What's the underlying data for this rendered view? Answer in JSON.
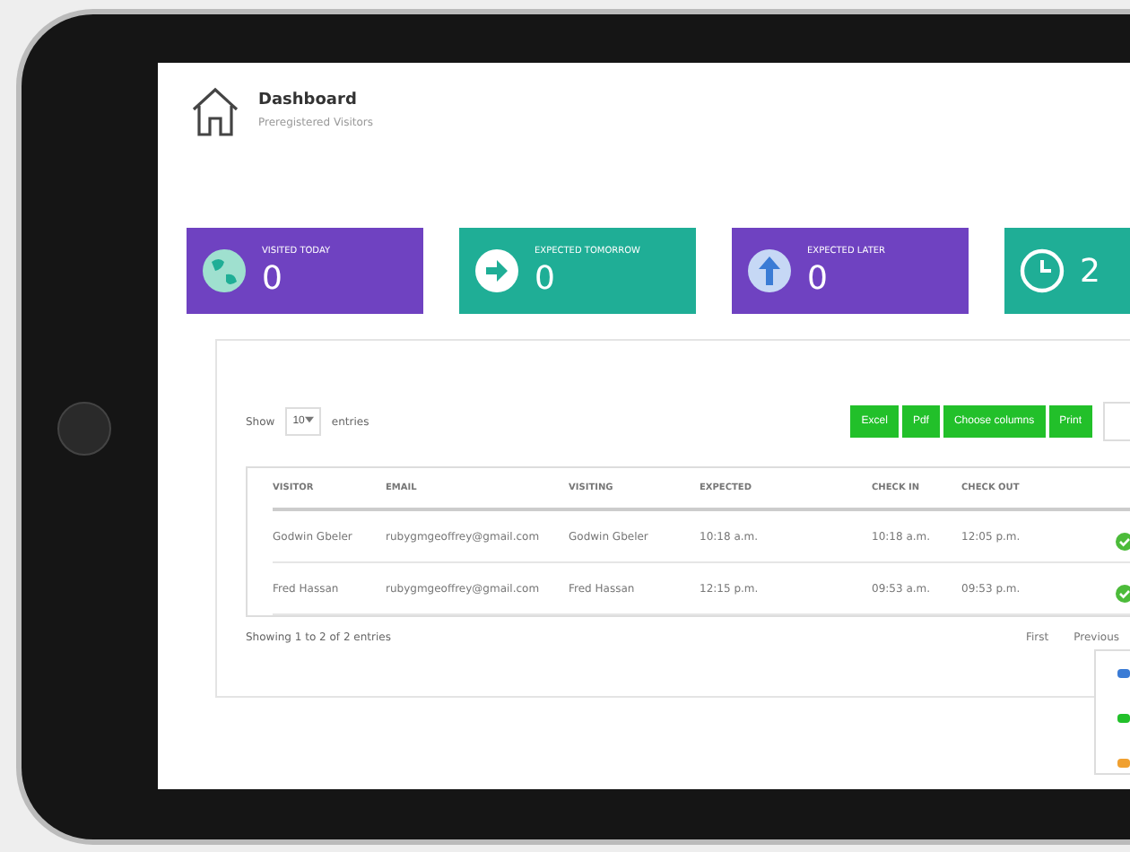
{
  "header": {
    "title": "Dashboard",
    "subtitle": "Preregistered Visitors"
  },
  "cards": [
    {
      "kind": "globe",
      "label": "VISITED TODAY",
      "value": "0",
      "color": "#6f42c1"
    },
    {
      "kind": "arrow",
      "label": "EXPECTED TOMORROW",
      "value": "0",
      "color": "#1fae96"
    },
    {
      "kind": "up",
      "label": "EXPECTED LATER",
      "value": "0",
      "color": "#6f42c1"
    },
    {
      "kind": "clock",
      "value": "2",
      "color": "#1fae96"
    }
  ],
  "table_controls": {
    "show": "Show",
    "page_size": "10",
    "entries": "entries",
    "buttons": [
      "Excel",
      "Pdf",
      "Choose columns",
      "Print"
    ]
  },
  "table": {
    "columns": [
      "VISITOR",
      "EMAIL",
      "VISITING",
      "EXPECTED",
      "CHECK IN",
      "CHECK OUT"
    ],
    "rows": [
      [
        "Godwin Gbeler",
        "rubygmgeoffrey@gmail.com",
        "Godwin Gbeler",
        "10:18 a.m.",
        "10:18 a.m.",
        "12:05 p.m."
      ],
      [
        "Fred Hassan",
        "rubygmgeoffrey@gmail.com",
        "Fred Hassan",
        "12:15 p.m.",
        "09:53 a.m.",
        "09:53 p.m."
      ]
    ]
  },
  "footer": {
    "info": "Showing 1 to 2 of 2 entries",
    "pager": [
      "First",
      "Previous"
    ]
  },
  "dropdown_dots": [
    {
      "color": "#3a7bd5"
    },
    {
      "color": "#22c02a"
    },
    {
      "color": "#f0a030"
    }
  ]
}
